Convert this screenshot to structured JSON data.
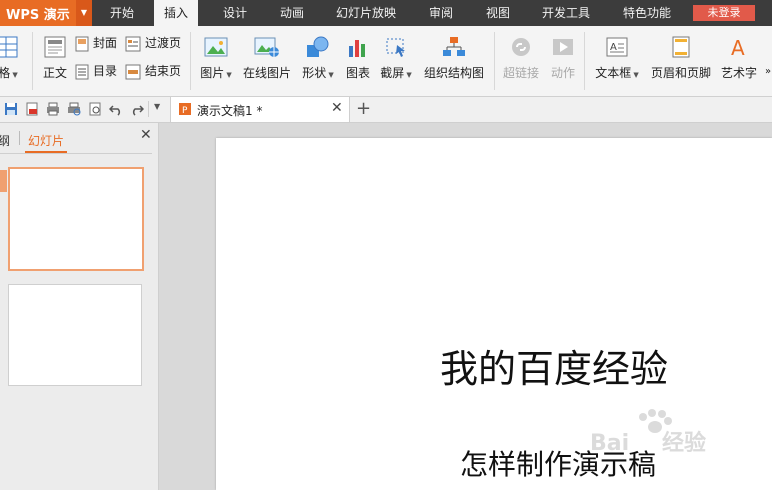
{
  "app": {
    "name": "WPS 演示",
    "accent": "#e86c24"
  },
  "menu": {
    "items": [
      "开始",
      "插入",
      "设计",
      "动画",
      "幻灯片放映",
      "审阅",
      "视图",
      "开发工具",
      "特色功能"
    ],
    "active": "插入",
    "login": "未登录"
  },
  "ribbon": {
    "table_partial": "格",
    "text": "正文",
    "cover": "封面",
    "toc": "目录",
    "transition": "过渡页",
    "end": "结束页",
    "picture": "图片",
    "online_picture": "在线图片",
    "shapes": "形状",
    "chart": "图表",
    "screenshot": "截屏",
    "org_chart": "组织结构图",
    "hyperlink": "超链接",
    "action": "动作",
    "textbox": "文本框",
    "header_footer": "页眉和页脚",
    "wordart": "艺术字"
  },
  "document": {
    "tab_title": "演示文稿1 *"
  },
  "left_pane": {
    "outline_tab": "纲",
    "slides_tab": "幻灯片"
  },
  "slide": {
    "title": "我的百度经验",
    "subtitle": "怎样制作演示稿"
  },
  "watermark": {
    "text": "Baidu经验"
  }
}
